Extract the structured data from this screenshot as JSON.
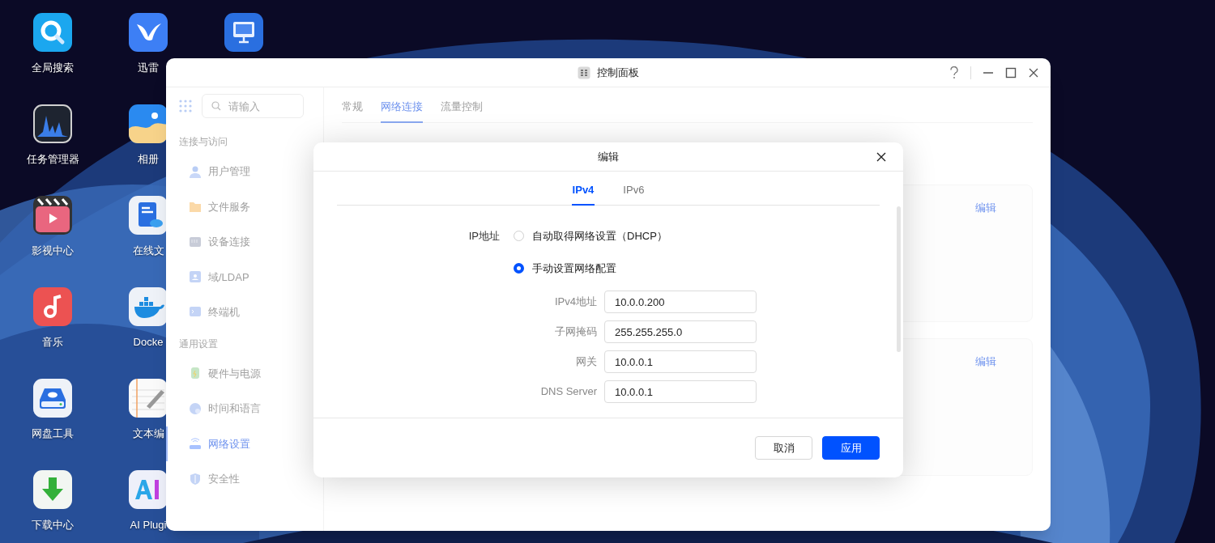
{
  "desktop": {
    "icons": [
      {
        "label": "全局搜索",
        "kind": "search"
      },
      {
        "label": "任务管理器",
        "kind": "monitor"
      },
      {
        "label": "影视中心",
        "kind": "video"
      },
      {
        "label": "音乐",
        "kind": "music"
      },
      {
        "label": "网盘工具",
        "kind": "disk"
      },
      {
        "label": "下载中心",
        "kind": "download"
      },
      {
        "label": "迅雷",
        "kind": "bird"
      },
      {
        "label": "相册",
        "kind": "photos"
      },
      {
        "label": "在线文",
        "kind": "doc"
      },
      {
        "label": "Docke",
        "kind": "docker"
      },
      {
        "label": "文本编",
        "kind": "notes"
      },
      {
        "label": "AI Plugi",
        "kind": "ai"
      },
      {
        "kind": "vm"
      }
    ]
  },
  "window": {
    "title": "控制面板",
    "sidebar": {
      "search": {
        "placeholder": "请输入"
      },
      "sections": [
        {
          "title": "连接与访问",
          "items": [
            {
              "label": "用户管理",
              "kind": "user",
              "selected": false
            },
            {
              "label": "文件服务",
              "kind": "folder",
              "selected": false
            },
            {
              "label": "设备连接",
              "kind": "device",
              "selected": false
            },
            {
              "label": "域/LDAP",
              "kind": "ldap",
              "selected": false
            },
            {
              "label": "终端机",
              "kind": "terminal",
              "selected": false
            }
          ]
        },
        {
          "title": "通用设置",
          "items": [
            {
              "label": "硬件与电源",
              "kind": "battery",
              "selected": false
            },
            {
              "label": "时间和语言",
              "kind": "clock",
              "selected": false
            },
            {
              "label": "网络设置",
              "kind": "network",
              "selected": true
            },
            {
              "label": "安全性",
              "kind": "shield",
              "selected": false
            }
          ]
        }
      ]
    },
    "tabs": [
      {
        "label": "常规",
        "selected": false
      },
      {
        "label": "网络连接",
        "selected": true
      },
      {
        "label": "流量控制",
        "selected": false
      }
    ],
    "cards": [
      {
        "action": "编辑"
      },
      {
        "action": "编辑"
      }
    ]
  },
  "dialog": {
    "title": "编辑",
    "tabs": [
      {
        "label": "IPv4",
        "selected": true
      },
      {
        "label": "IPv6",
        "selected": false
      }
    ],
    "ip_label": "IP地址",
    "options": [
      {
        "label": "自动取得网络设置（DHCP）",
        "selected": false
      },
      {
        "label": "手动设置网络配置",
        "selected": true
      }
    ],
    "fields": [
      {
        "label": "IPv4地址",
        "value": "10.0.0.200"
      },
      {
        "label": "子网掩码",
        "value": "255.255.255.0"
      },
      {
        "label": "网关",
        "value": "10.0.0.1"
      },
      {
        "label": "DNS Server",
        "value": "10.0.0.1"
      }
    ],
    "buttons": [
      {
        "label": "取消",
        "kind": "secondary"
      },
      {
        "label": "应用",
        "kind": "primary"
      }
    ]
  }
}
